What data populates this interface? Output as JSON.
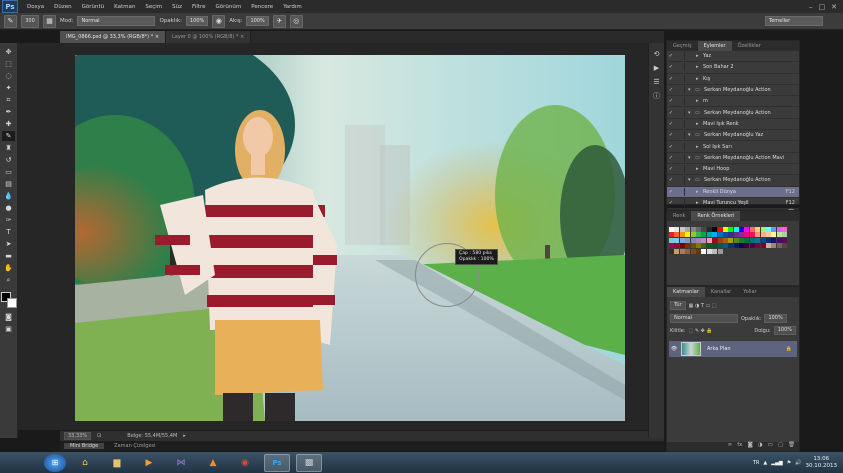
{
  "app": {
    "logo": "Ps"
  },
  "menu": [
    "Dosya",
    "Düzen",
    "Görüntü",
    "Katman",
    "Seçim",
    "Süz",
    "Filtre",
    "Görünüm",
    "Pencere",
    "Yardım"
  ],
  "options": {
    "mode_label": "Mod:",
    "mode_value": "Normal",
    "opacity_label": "Opaklık:",
    "opacity_value": "100%",
    "flow_label": "Akış:",
    "flow_value": "100%",
    "size_value": "300",
    "workspace": "Temeller"
  },
  "doc_tabs": [
    {
      "label": "IMG_0866.psd @ 33,3% (RGB/8*) *",
      "close": "×"
    },
    {
      "label": "Layer 0 @ 100% (RGB/8) *",
      "close": "×"
    }
  ],
  "brush_tooltip": {
    "line1": "Çap : 580 piks",
    "line2": "Opaklık : 100%"
  },
  "status": {
    "zoom": "33,33%",
    "doc": "Belge: 55,4M/55,4M"
  },
  "mini_bridge": [
    "Mini Bridge",
    "Zaman Çizelgesi"
  ],
  "actions_panel": {
    "tabs": [
      "Geçmiş",
      "Eylemler",
      "Özellikler"
    ],
    "rows": [
      {
        "label": "Yaz",
        "indent": 2,
        "type": "item",
        "key": ""
      },
      {
        "label": "Son Bahar 2",
        "indent": 2,
        "type": "item",
        "key": ""
      },
      {
        "label": "Kış",
        "indent": 2,
        "type": "item",
        "key": ""
      },
      {
        "label": "Serkan Meydanoğlu Action",
        "indent": 1,
        "type": "folder",
        "key": ""
      },
      {
        "label": "m",
        "indent": 2,
        "type": "item",
        "key": ""
      },
      {
        "label": "Serkan Meydanoğlu Action",
        "indent": 1,
        "type": "folder",
        "key": ""
      },
      {
        "label": "Mavi Işık Renk",
        "indent": 2,
        "type": "item",
        "key": ""
      },
      {
        "label": "Serkan Meydanoğlu Yaz",
        "indent": 1,
        "type": "folder",
        "key": ""
      },
      {
        "label": "Sol Işık Sarı",
        "indent": 2,
        "type": "item",
        "key": ""
      },
      {
        "label": "Serkan Meydanoğlu Action Mavi",
        "indent": 1,
        "type": "folder",
        "key": ""
      },
      {
        "label": "Mavi Hoop",
        "indent": 2,
        "type": "item",
        "key": ""
      },
      {
        "label": "Serkan Meydanoğlu Action",
        "indent": 1,
        "type": "folder",
        "key": ""
      },
      {
        "label": "Renkli Dünya",
        "indent": 2,
        "type": "item",
        "key": "F12",
        "selected": true
      },
      {
        "label": "Mavi Turuncu Yeşil",
        "indent": 2,
        "type": "item",
        "key": "F12"
      }
    ]
  },
  "swatches_panel": {
    "tabs": [
      "Renk",
      "Renk Örnekleri"
    ],
    "colors": [
      "#ffffff",
      "#e8e8e8",
      "#c8c8c8",
      "#a8a8a8",
      "#888888",
      "#686868",
      "#484848",
      "#282828",
      "#000000",
      "#ff0000",
      "#ffff00",
      "#00ff00",
      "#00ffff",
      "#0000ff",
      "#ff00ff",
      "#ff6666",
      "#ffcc66",
      "#99ff66",
      "#66ffff",
      "#6699ff",
      "#cc66ff",
      "#ff66cc",
      "#ed1c24",
      "#f26522",
      "#f7941d",
      "#fff200",
      "#8dc63f",
      "#39b54a",
      "#00a651",
      "#00a99d",
      "#00aeef",
      "#0072bc",
      "#0054a6",
      "#2e3192",
      "#662d91",
      "#92278f",
      "#ec008c",
      "#ed145b",
      "#f69679",
      "#f9ad81",
      "#fdc68a",
      "#fff799",
      "#c4df9b",
      "#a3d39c",
      "#7accc8",
      "#6dcff6",
      "#7da7d9",
      "#8393ca",
      "#8781bd",
      "#a186be",
      "#bd8cbf",
      "#f49ac1",
      "#9e0b0f",
      "#a0410d",
      "#a36209",
      "#aba000",
      "#598527",
      "#197b30",
      "#007236",
      "#00746b",
      "#0076a3",
      "#004a80",
      "#003471",
      "#1b1464",
      "#440e62",
      "#630460",
      "#9e005d",
      "#9e0039",
      "#790000",
      "#7b2e00",
      "#7d4900",
      "#827b00",
      "#406618",
      "#005e20",
      "#005826",
      "#005952",
      "#005b7f",
      "#003663",
      "#002157",
      "#0d004c",
      "#32004b",
      "#4b0049",
      "#7b0046",
      "#7a0026",
      "#c7b299",
      "#998675",
      "#736357",
      "#534741",
      "#37302a",
      "#c69c6d",
      "#a67c52",
      "#8c6239",
      "#754c24",
      "#603913",
      "#ffffff",
      "#dddddd",
      "#bbbbbb",
      "#999999"
    ]
  },
  "layers_panel": {
    "tabs": [
      "Katmanlar",
      "Kanallar",
      "Yollar"
    ],
    "kind_label": "Tür",
    "blend": "Normal",
    "opacity_label": "Opaklık:",
    "opacity_value": "100%",
    "lock_label": "Kilitle:",
    "fill_label": "Dolgu:",
    "fill_value": "100%",
    "layer_name": "Arka Plan"
  },
  "taskbar": {
    "lang": "TR",
    "time": "13:06",
    "date": "30.10.2013"
  },
  "colors": {
    "selection": "#6b6f8c",
    "accent": "#3d6da8"
  }
}
